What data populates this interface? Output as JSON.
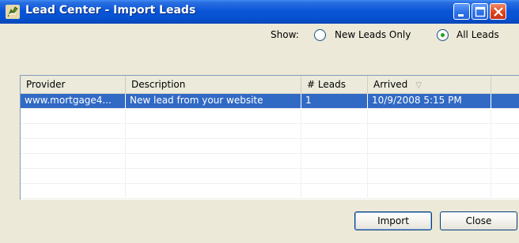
{
  "window": {
    "title": "Lead Center - Import Leads",
    "titlebar_color": "#0a55d8"
  },
  "titlebar_buttons": {
    "minimize_icon": "minimize-icon",
    "maximize_icon": "maximize-icon",
    "close_icon": "close-icon"
  },
  "show": {
    "label": "Show:",
    "options": [
      {
        "label": "New Leads Only",
        "checked": false
      },
      {
        "label": "All Leads",
        "checked": true
      }
    ]
  },
  "table": {
    "columns": [
      "Provider",
      "Description",
      "# Leads",
      "Arrived"
    ],
    "sort_indicator": "▽",
    "rows": [
      {
        "provider": "www.mortgage4...",
        "description": "New lead from your website",
        "leads": "1",
        "arrived": "10/9/2008 5:15 PM",
        "selected": true
      }
    ],
    "selection_color": "#316ac5"
  },
  "buttons": {
    "import_label": "Import",
    "close_label": "Close"
  }
}
